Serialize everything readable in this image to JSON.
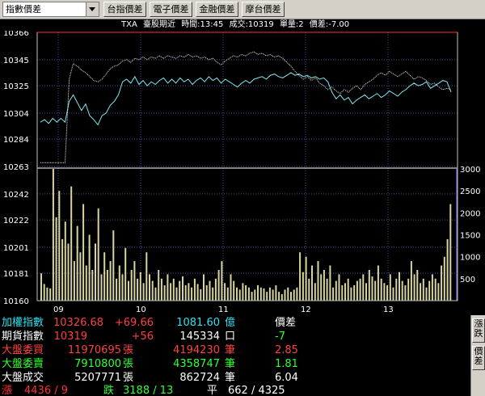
{
  "toolbar": {
    "combo_value": "指數價差",
    "buttons": [
      "台指價差",
      "電子價差",
      "金融價差",
      "摩台價差"
    ]
  },
  "info": {
    "symbol": "TXA",
    "name": "臺股期近",
    "time": "時間:13:45",
    "volume": "成交:10319",
    "units": "單量:2",
    "spread": "價差:-7.00"
  },
  "chart_data": {
    "type": "line",
    "price_axis": {
      "ticks": [
        "10366",
        "10345",
        "10325",
        "10304",
        "10284",
        "10263",
        "10242",
        "10222",
        "10201",
        "10181",
        "10160"
      ],
      "range": [
        10160,
        10366
      ]
    },
    "volume_axis": {
      "ticks": [
        "3000",
        "2500",
        "2000",
        "1500",
        "1000",
        "500"
      ],
      "range": [
        0,
        3000
      ]
    },
    "x_labels": [
      "09",
      "10",
      "11",
      "12",
      "13"
    ],
    "series": [
      {
        "name": "",
        "color": "#80e8f0",
        "x": [
          0,
          3,
          6,
          9,
          12,
          15,
          18,
          21,
          24,
          27,
          30,
          33,
          36,
          39,
          42,
          45,
          48,
          51,
          54,
          57,
          60,
          63,
          66,
          69,
          72,
          75,
          78,
          81,
          84,
          87,
          90,
          93,
          96,
          99,
          102,
          105,
          108,
          111,
          114,
          117,
          120,
          123,
          126,
          129,
          132,
          135,
          138,
          141,
          144,
          147,
          150,
          153,
          156,
          159,
          162,
          165,
          168,
          171,
          174,
          177,
          180,
          183,
          186,
          189,
          192,
          195,
          198,
          201,
          204,
          207,
          210,
          213,
          216,
          219,
          222,
          225,
          228,
          231,
          234,
          237,
          240,
          243,
          246,
          249,
          252,
          255,
          258,
          261,
          264,
          267,
          270,
          273,
          276,
          279,
          282,
          285,
          288,
          291,
          294,
          297,
          300
        ],
        "values": [
          10297,
          10299,
          10296,
          10300,
          10297,
          10300,
          10297,
          10313,
          10318,
          10312,
          10306,
          10311,
          10302,
          10299,
          10295,
          10302,
          10304,
          10310,
          10313,
          10318,
          10328,
          10330,
          10327,
          10332,
          10326,
          10329,
          10325,
          10328,
          10326,
          10329,
          10331,
          10327,
          10330,
          10327,
          10331,
          10328,
          10330,
          10326,
          10329,
          10331,
          10328,
          10332,
          10329,
          10331,
          10327,
          10330,
          10328,
          10326,
          10324,
          10327,
          10329,
          10327,
          10330,
          10331,
          10332,
          10330,
          10333,
          10334,
          10332,
          10331,
          10333,
          10335,
          10333,
          10334,
          10332,
          10333,
          10331,
          10332,
          10330,
          10331,
          10328,
          10320,
          10315,
          10318,
          10314,
          10316,
          10311,
          10314,
          10316,
          10318,
          10315,
          10317,
          10319,
          10316,
          10318,
          10321,
          10319,
          10317,
          10320,
          10322,
          10325,
          10327,
          10325,
          10326,
          10328,
          10323,
          10325,
          10327,
          10329,
          10328,
          10320
        ]
      },
      {
        "name": "",
        "color": "#e8e8e8",
        "x": [
          0,
          3,
          6,
          9,
          12,
          15,
          18,
          21,
          24,
          27,
          30,
          33,
          36,
          39,
          42,
          45,
          48,
          51,
          54,
          57,
          60,
          63,
          66,
          69,
          72,
          75,
          78,
          81,
          84,
          87,
          90,
          93,
          96,
          99,
          102,
          105,
          108,
          111,
          114,
          117,
          120,
          123,
          126,
          129,
          132,
          135,
          138,
          141,
          144,
          147,
          150,
          153,
          156,
          159,
          162,
          165,
          168,
          171,
          174,
          177,
          180,
          183,
          186,
          189,
          192,
          195,
          198,
          201,
          204,
          207,
          210,
          213,
          216,
          219,
          222,
          225,
          228,
          231,
          234,
          237,
          240,
          243,
          246,
          249,
          252,
          255,
          258,
          261,
          264,
          267,
          270,
          273,
          276,
          279,
          282,
          285,
          288,
          291,
          294,
          297,
          300
        ],
        "values": [
          10266,
          10266,
          10266,
          10266,
          10266,
          10266,
          10266,
          10330,
          10342,
          10340,
          10337,
          10335,
          10332,
          10329,
          10328,
          10330,
          10334,
          10338,
          10340,
          10341,
          10344,
          10345,
          10343,
          10346,
          10345,
          10347,
          10345,
          10347,
          10346,
          10348,
          10346,
          10348,
          10347,
          10346,
          10348,
          10347,
          10349,
          10347,
          10348,
          10346,
          10347,
          10345,
          10346,
          10343,
          10341,
          10344,
          10346,
          10348,
          10347,
          10349,
          10348,
          10350,
          10351,
          10349,
          10350,
          10348,
          10349,
          10347,
          10348,
          10346,
          10343,
          10340,
          10336,
          10333,
          10330,
          10332,
          10329,
          10331,
          10327,
          10325,
          10322,
          10324,
          10321,
          10319,
          10322,
          10320,
          10323,
          10325,
          10322,
          10326,
          10328,
          10330,
          10333,
          10335,
          10333,
          10336,
          10334,
          10332,
          10334,
          10336,
          10333,
          10330,
          10332,
          10331,
          10329,
          10326,
          10327,
          10324,
          10322,
          10323,
          10322
        ]
      }
    ],
    "volume_bars": [
      620,
      380,
      300,
      280,
      3000,
      1900,
      2500,
      1400,
      1800,
      1300,
      2600,
      900,
      1700,
      1100,
      2200,
      800,
      1500,
      700,
      1300,
      2100,
      600,
      1100,
      700,
      900,
      1600,
      500,
      800,
      600,
      1200,
      450,
      700,
      900,
      500,
      650,
      400,
      1100,
      600,
      450,
      300,
      700,
      500,
      350,
      600,
      400,
      500,
      300,
      450,
      550,
      350,
      400,
      300,
      500,
      380,
      260,
      600,
      350,
      450,
      300,
      500,
      700,
      900,
      400,
      300,
      600,
      450,
      300,
      250,
      400,
      350,
      300,
      200,
      250,
      350,
      300,
      280,
      200,
      300,
      250,
      350,
      200,
      150,
      250,
      300,
      200,
      250,
      300,
      1100,
      650,
      1000,
      500,
      800,
      400,
      900,
      600,
      700,
      500,
      800,
      300,
      450,
      600,
      350,
      400,
      500,
      300,
      350,
      450,
      500,
      600,
      400,
      700,
      550,
      450,
      800,
      500,
      400,
      350,
      600,
      300,
      500,
      650,
      450,
      350,
      500,
      900,
      600,
      700,
      400,
      500,
      300,
      450,
      600,
      500,
      400,
      800,
      1000,
      1400,
      2200
    ]
  },
  "panel": {
    "rows": [
      {
        "label": "加權指數",
        "v1": "10326.68",
        "v2": "+69.66",
        "v3": "1081.60",
        "u3": "億",
        "v4": "價差"
      },
      {
        "label": "期貨指數",
        "v1": "10319",
        "v2": "+56",
        "v3": "145334",
        "u3": "口",
        "v4": "-7"
      },
      {
        "label": "大盤委買",
        "v1": "11970695",
        "u1": "張",
        "v3": "4194230",
        "u3": "筆",
        "v4": "2.85"
      },
      {
        "label": "大盤委賣",
        "v1": "7910800",
        "u1": "張",
        "v3": "4358747",
        "u3": "筆",
        "v4": "1.81"
      },
      {
        "label": "大盤成交",
        "v1": "5207771",
        "u1": "張",
        "v3": "862724",
        "u3": "筆",
        "v4": "6.04"
      }
    ],
    "last": {
      "up_label": "漲",
      "up_value": "4436 / 9",
      "down_label": "跌",
      "down_value": "3188 / 13",
      "flat_label": "平",
      "flat_value": "662 / 4325"
    }
  },
  "side_tabs": [
    "漲跌",
    "價差"
  ],
  "colors": {
    "chart_bg": "#000000",
    "grid": "#4a4a9a",
    "frame": "#c0c0c0",
    "price_line": "#80e8f0",
    "index_line": "#e8e8e8",
    "volume": "#d8d4a0"
  }
}
